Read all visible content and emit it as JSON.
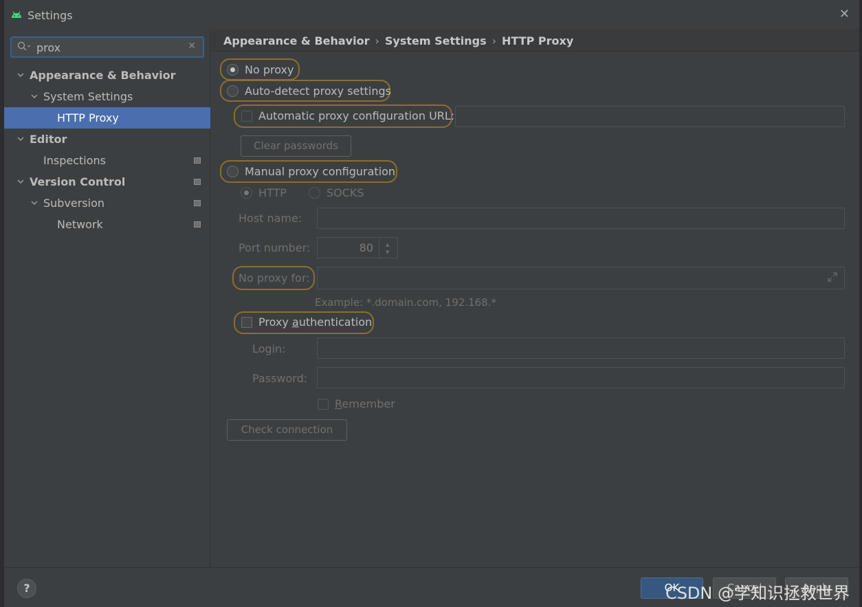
{
  "window": {
    "title": "Settings",
    "close_glyph": "✕"
  },
  "search": {
    "value": "prox",
    "clear_glyph": "✕",
    "search_glyph": "⌕"
  },
  "tree": {
    "items": [
      {
        "label": "Appearance & Behavior",
        "expanded": true
      },
      {
        "label": "System Settings",
        "expanded": true
      },
      {
        "label": "HTTP Proxy",
        "selected": true
      },
      {
        "label": "Editor",
        "expanded": true
      },
      {
        "label": "Inspections"
      },
      {
        "label": "Version Control",
        "expanded": true
      },
      {
        "label": "Subversion",
        "expanded": true
      },
      {
        "label": "Network"
      }
    ]
  },
  "breadcrumb": {
    "parts": [
      "Appearance & Behavior",
      "System Settings",
      "HTTP Proxy"
    ],
    "sep": "›"
  },
  "proxy": {
    "no_proxy": "No proxy",
    "auto_detect": "Auto-detect proxy settings",
    "auto_config_url": "Automatic proxy configuration URL:",
    "clear_passwords": "Clear passwords",
    "manual": "Manual proxy configuration",
    "http": "HTTP",
    "socks": "SOCKS",
    "host_name": "Host name:",
    "port_number": "Port number:",
    "port_value": "80",
    "no_proxy_for": "No proxy for:",
    "example": "Example: *.domain.com, 192.168.*",
    "proxy_auth_pre": "Proxy ",
    "proxy_auth_u": "a",
    "proxy_auth_post": "uthentication",
    "login": "Login:",
    "password": "Password:",
    "remember_u": "R",
    "remember_post": "emember",
    "check_connection": "Check connection"
  },
  "footer": {
    "help": "?",
    "ok": "OK",
    "cancel": "Cancel",
    "apply": "Apply",
    "watermark": "CSDN @学知识拯救世界"
  },
  "colors": {
    "accent": "#4b6eaf",
    "highlight": "#8c6e2d",
    "primary_button": "#365880"
  }
}
